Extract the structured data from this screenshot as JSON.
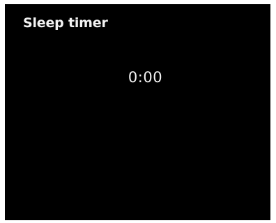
{
  "screen": {
    "title": "Sleep timer",
    "timer_value": "0:00"
  },
  "colors": {
    "background": "#000000",
    "text": "#f2f2f2",
    "frame": "#ffffff"
  }
}
